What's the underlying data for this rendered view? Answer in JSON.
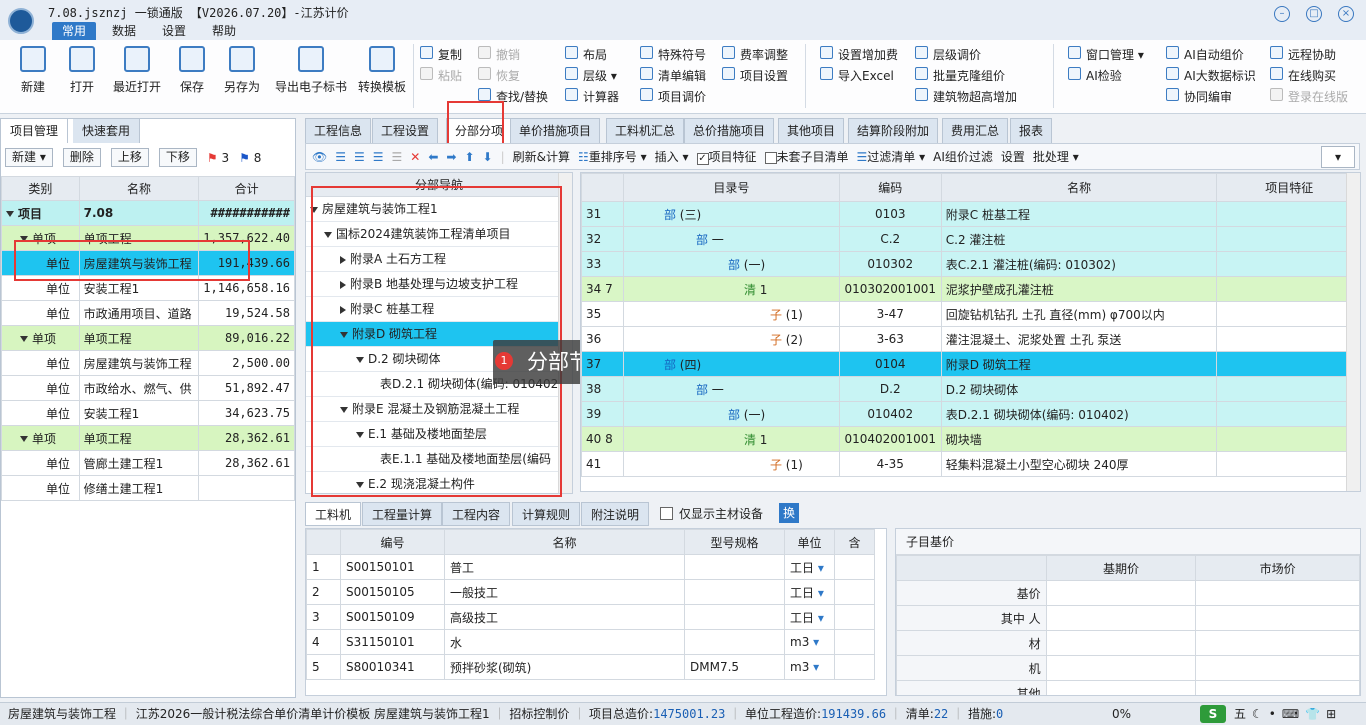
{
  "app": {
    "title": "7.08.jsznzj 一锁通版 【V2026.07.20】-江苏计价",
    "menus": [
      "常用",
      "数据",
      "设置",
      "帮助"
    ]
  },
  "ribbon": {
    "big": [
      "新建",
      "打开",
      "最近打开",
      "保存",
      "另存为",
      "导出电子标书",
      "转换模板"
    ],
    "col1": [
      "复制",
      "粘贴"
    ],
    "col1b": [
      "撤销",
      "恢复",
      "查找/替换"
    ],
    "col2": [
      "布局",
      "层级",
      "计算器"
    ],
    "col3": [
      "特殊符号",
      "清单编辑",
      "项目调价"
    ],
    "col4": [
      "费率调整",
      "项目设置"
    ],
    "col5": [
      "设置增加费",
      "导入Excel"
    ],
    "col6": [
      "层级调价",
      "批量克隆组价",
      "建筑物超高增加"
    ],
    "col7": [
      "窗口管理",
      "AI检验"
    ],
    "col8": [
      "AI自动组价",
      "AI大数据标识",
      "协同编审"
    ],
    "col9": [
      "远程协助",
      "在线购买",
      "登录在线版"
    ]
  },
  "left": {
    "tabs": [
      "项目管理",
      "快速套用"
    ],
    "tools": [
      "新建",
      "删除",
      "上移",
      "下移"
    ],
    "flag_red": "3",
    "flag_blue": "8",
    "headers": [
      "类别",
      "名称",
      "合计"
    ],
    "rows": [
      {
        "type": "项目",
        "name": "7.08",
        "total": "###########"
      },
      {
        "type": "单项",
        "name": "单项工程",
        "total": "1,357,622.40"
      },
      {
        "type": "单位",
        "name": "房屋建筑与装饰工程",
        "total": "191,439.66"
      },
      {
        "type": "单位",
        "name": "安装工程1",
        "total": "1,146,658.16"
      },
      {
        "type": "单位",
        "name": "市政通用项目、道路",
        "total": "19,524.58"
      },
      {
        "type": "单项",
        "name": "单项工程",
        "total": "89,016.22"
      },
      {
        "type": "单位",
        "name": "房屋建筑与装饰工程",
        "total": "2,500.00"
      },
      {
        "type": "单位",
        "name": "市政给水、燃气、供",
        "total": "51,892.47"
      },
      {
        "type": "单位",
        "name": "安装工程1",
        "total": "34,623.75"
      },
      {
        "type": "单项",
        "name": "单项工程",
        "total": "28,362.61"
      },
      {
        "type": "单位",
        "name": "管廊土建工程1",
        "total": "28,362.61"
      },
      {
        "type": "单位",
        "name": "修缮土建工程1",
        "total": ""
      }
    ]
  },
  "main_tabs": [
    "工程信息",
    "工程设置",
    "分部分项",
    "单价措施项目",
    "工料机汇总",
    "总价措施项目",
    "其他项目",
    "结算阶段附加",
    "费用汇总",
    "报表"
  ],
  "toolbar": [
    "刷新&计算",
    "重排序号",
    "插入",
    "项目特征",
    "未套子目清单",
    "过滤清单",
    "AI组价过滤",
    "设置",
    "批处理"
  ],
  "tree": {
    "header": "分部导航",
    "items": [
      "房屋建筑与装饰工程1",
      "国标2024建筑装饰工程清单项目",
      "附录A 土石方工程",
      "附录B 地基处理与边坡支护工程",
      "附录C 桩基工程",
      "附录D 砌筑工程",
      "D.2 砌块砌体",
      "表D.2.1 砌块砌体(编码: 010402",
      "附录E 混凝土及钢筋混凝土工程",
      "E.1 基础及楼地面垫层",
      "表E.1.1 基础及楼地面垫层(编码",
      "E.2 现浇混凝土构件"
    ]
  },
  "callout": {
    "num": "1",
    "text": "分部节点"
  },
  "grid": {
    "headers": [
      "",
      "目录号",
      "编码",
      "名称",
      "项目特征"
    ],
    "rows": [
      {
        "no": "31",
        "lvl": "部",
        "dir": "(三)",
        "code": "0103",
        "name": "附录C 桩基工程"
      },
      {
        "no": "32",
        "lvl": "部",
        "dir": "一",
        "code": "C.2",
        "name": "C.2 灌注桩"
      },
      {
        "no": "33",
        "lvl": "部",
        "dir": "(一)",
        "code": "010302",
        "name": "表C.2.1 灌注桩(编码: 010302)"
      },
      {
        "no": "34 7",
        "lvl": "清",
        "dir": "1",
        "code": "010302001001",
        "name": "泥浆护壁成孔灌注桩"
      },
      {
        "no": "35",
        "lvl": "子",
        "dir": "(1)",
        "code": "3-47",
        "name": "回旋钻机钻孔 土孔 直径(mm) φ700以内"
      },
      {
        "no": "36",
        "lvl": "子",
        "dir": "(2)",
        "code": "3-63",
        "name": "灌注混凝土、泥浆处置 土孔 泵送"
      },
      {
        "no": "37",
        "lvl": "部",
        "dir": "(四)",
        "code": "0104",
        "name": "附录D 砌筑工程"
      },
      {
        "no": "38",
        "lvl": "部",
        "dir": "一",
        "code": "D.2",
        "name": "D.2 砌块砌体"
      },
      {
        "no": "39",
        "lvl": "部",
        "dir": "(一)",
        "code": "010402",
        "name": "表D.2.1 砌块砌体(编码: 010402)"
      },
      {
        "no": "40 8",
        "lvl": "清",
        "dir": "1",
        "code": "010402001001",
        "name": "砌块墙"
      },
      {
        "no": "41",
        "lvl": "子",
        "dir": "(1)",
        "code": "4-35",
        "name": "轻集料混凝土小型空心砌块 240厚"
      }
    ]
  },
  "bottom": {
    "tabs": [
      "工料机",
      "工程量计算",
      "工程内容",
      "计算规则",
      "附注说明"
    ],
    "only_main": "仅显示主材设备",
    "swap": "换",
    "headers": [
      "",
      "编号",
      "名称",
      "型号规格",
      "单位",
      "含"
    ],
    "rows": [
      {
        "n": "1",
        "code": "S00150101",
        "name": "普工",
        "spec": "",
        "unit": "工日"
      },
      {
        "n": "2",
        "code": "S00150105",
        "name": "一般技工",
        "spec": "",
        "unit": "工日"
      },
      {
        "n": "3",
        "code": "S00150109",
        "name": "高级技工",
        "spec": "",
        "unit": "工日"
      },
      {
        "n": "4",
        "code": "S31150101",
        "name": "水",
        "spec": "",
        "unit": "m3"
      },
      {
        "n": "5",
        "code": "S80010341",
        "name": "预拌砂浆(砌筑)",
        "spec": "DMM7.5",
        "unit": "m3"
      }
    ]
  },
  "price": {
    "tab": "子目基价",
    "headers": [
      "",
      "基期价",
      "市场价"
    ],
    "rows": [
      "基价",
      "其中 人",
      "材",
      "机",
      "其他"
    ]
  },
  "status": {
    "project": "房屋建筑与装饰工程",
    "template": "江苏2026一般计税法综合单价清单计价模板 房屋建筑与装饰工程1",
    "mode": "招标控制价",
    "total_label": "项目总造价:",
    "total": "1475001.23",
    "unit_label": "单位工程造价:",
    "unit": "191439.66",
    "list_label": "清单:",
    "list": "22",
    "measure_label": "措施:",
    "measure": "0",
    "percent": "0%"
  }
}
